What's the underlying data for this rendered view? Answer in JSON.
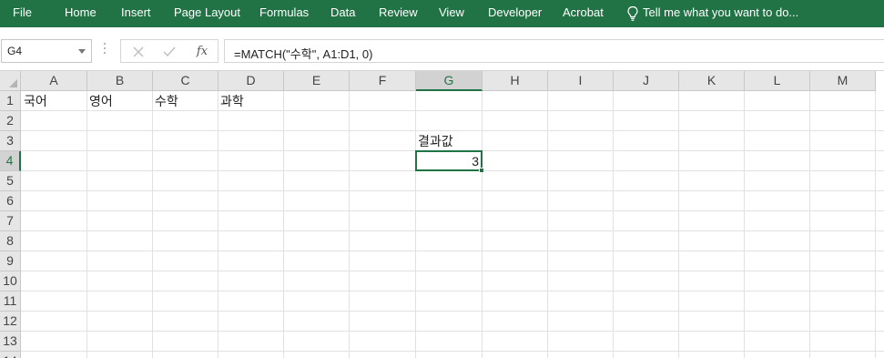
{
  "ribbon": {
    "tabs": [
      "File",
      "Home",
      "Insert",
      "Page Layout",
      "Formulas",
      "Data",
      "Review",
      "View",
      "Developer",
      "Acrobat"
    ],
    "tell_me": "Tell me what you want to do...",
    "tell_me_icon": "lightbulb-icon"
  },
  "formula_bar": {
    "name_box": "G4",
    "cancel_icon": "cancel-x-icon",
    "enter_icon": "check-icon",
    "fx_label": "fx",
    "formula": "=MATCH(\"수학\", A1:D1, 0)"
  },
  "sheet": {
    "columns": [
      "A",
      "B",
      "C",
      "D",
      "E",
      "F",
      "G",
      "H",
      "I",
      "J",
      "K",
      "L",
      "M"
    ],
    "rows": [
      "1",
      "2",
      "3",
      "4",
      "5",
      "6",
      "7",
      "8",
      "9",
      "10",
      "11",
      "12",
      "13",
      "14"
    ],
    "selected_column": "G",
    "selected_row": "4",
    "cells": {
      "A1": "국어",
      "B1": "영어",
      "C1": "수학",
      "D1": "과학",
      "G3": "결과값",
      "G4": "3"
    }
  }
}
